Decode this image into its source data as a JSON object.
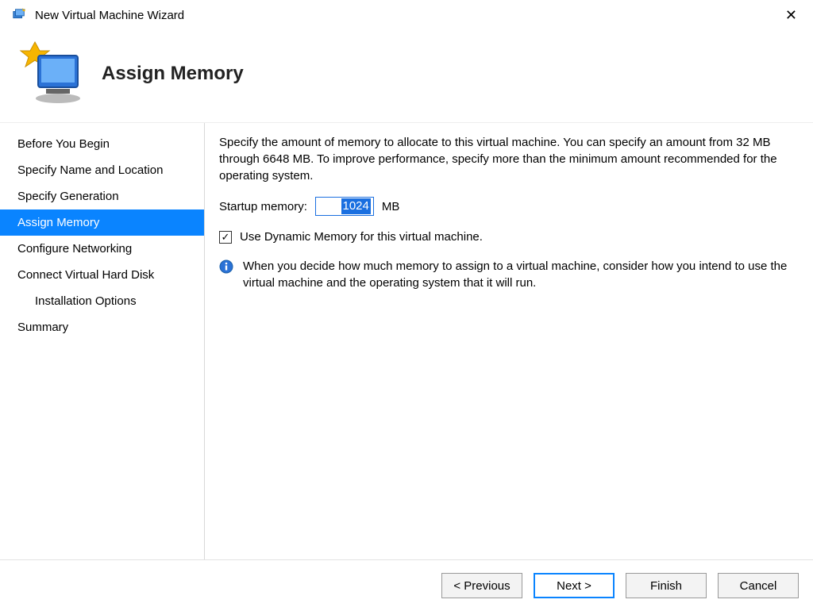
{
  "window": {
    "title": "New Virtual Machine Wizard"
  },
  "header": {
    "title": "Assign Memory"
  },
  "nav": {
    "items": [
      {
        "label": "Before You Begin",
        "active": false,
        "sub": false
      },
      {
        "label": "Specify Name and Location",
        "active": false,
        "sub": false
      },
      {
        "label": "Specify Generation",
        "active": false,
        "sub": false
      },
      {
        "label": "Assign Memory",
        "active": true,
        "sub": false
      },
      {
        "label": "Configure Networking",
        "active": false,
        "sub": false
      },
      {
        "label": "Connect Virtual Hard Disk",
        "active": false,
        "sub": false
      },
      {
        "label": "Installation Options",
        "active": false,
        "sub": true
      },
      {
        "label": "Summary",
        "active": false,
        "sub": false
      }
    ]
  },
  "content": {
    "description": "Specify the amount of memory to allocate to this virtual machine. You can specify an amount from 32 MB through 6648 MB. To improve performance, specify more than the minimum amount recommended for the operating system.",
    "startup_label": "Startup memory:",
    "startup_value": "1024",
    "startup_unit": "MB",
    "dynamic_checkbox_label": "Use Dynamic Memory for this virtual machine.",
    "dynamic_checked": true,
    "info_text": "When you decide how much memory to assign to a virtual machine, consider how you intend to use the virtual machine and the operating system that it will run."
  },
  "footer": {
    "previous": "< Previous",
    "next": "Next >",
    "finish": "Finish",
    "cancel": "Cancel"
  }
}
